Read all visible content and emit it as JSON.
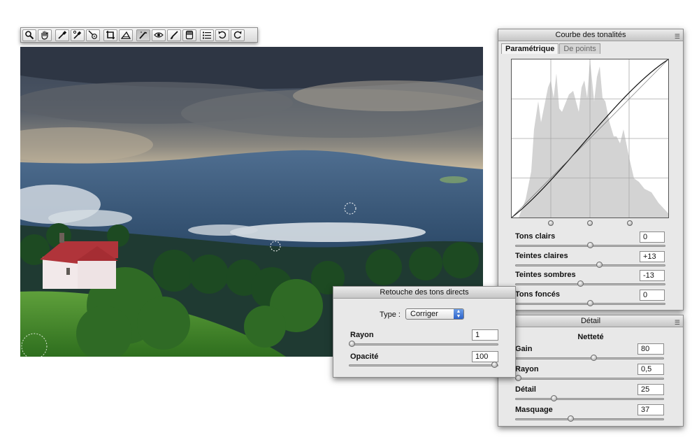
{
  "toolbar": {
    "tools": [
      {
        "name": "zoom-tool",
        "icon": "magnifier-icon"
      },
      {
        "name": "hand-tool",
        "icon": "hand-icon"
      },
      {
        "name": "white-balance-tool",
        "icon": "eyedropper-icon"
      },
      {
        "name": "color-sampler-tool",
        "icon": "color-sampler-icon"
      },
      {
        "name": "targeted-adjustment-tool",
        "icon": "target-adjust-icon"
      },
      {
        "name": "crop-tool",
        "icon": "crop-icon"
      },
      {
        "name": "straighten-tool",
        "icon": "straighten-icon"
      },
      {
        "name": "spot-removal-tool",
        "icon": "spot-removal-icon"
      },
      {
        "name": "red-eye-tool",
        "icon": "red-eye-icon"
      },
      {
        "name": "adjustment-brush-tool",
        "icon": "brush-icon"
      },
      {
        "name": "graduated-filter-tool",
        "icon": "graduated-filter-icon"
      },
      {
        "name": "preferences-tool",
        "icon": "list-icon"
      },
      {
        "name": "rotate-left-tool",
        "icon": "rotate-left-icon"
      },
      {
        "name": "rotate-right-tool",
        "icon": "rotate-right-icon"
      }
    ]
  },
  "tone_curve": {
    "title": "Courbe des tonalités",
    "tabs": [
      "Paramétrique",
      "De points"
    ],
    "active_tab": "Paramétrique",
    "sliders": [
      {
        "label": "Tons clairs",
        "value": "0",
        "position": 0.5
      },
      {
        "label": "Teintes claires",
        "value": "+13",
        "position": 0.565
      },
      {
        "label": "Teintes sombres",
        "value": "-13",
        "position": 0.435
      },
      {
        "label": "Tons foncés",
        "value": "0",
        "position": 0.5
      }
    ]
  },
  "detail": {
    "title": "Détail",
    "section": "Netteté",
    "sliders": [
      {
        "label": "Gain",
        "value": "80",
        "position": 0.53
      },
      {
        "label": "Rayon",
        "value": "0,5",
        "position": 0.0
      },
      {
        "label": "Détail",
        "value": "25",
        "position": 0.25
      },
      {
        "label": "Masquage",
        "value": "37",
        "position": 0.37
      }
    ]
  },
  "spot_removal": {
    "title": "Retouche des tons directs",
    "type_label": "Type :",
    "type_value": "Corriger",
    "sliders": [
      {
        "label": "Rayon",
        "value": "1",
        "position": 0.0
      },
      {
        "label": "Opacité",
        "value": "100",
        "position": 1.0
      }
    ]
  },
  "colors": {
    "panel_bg": "#e8e8e8",
    "histogram": "#d3d3d3",
    "select_accent": "#2c62c9"
  }
}
